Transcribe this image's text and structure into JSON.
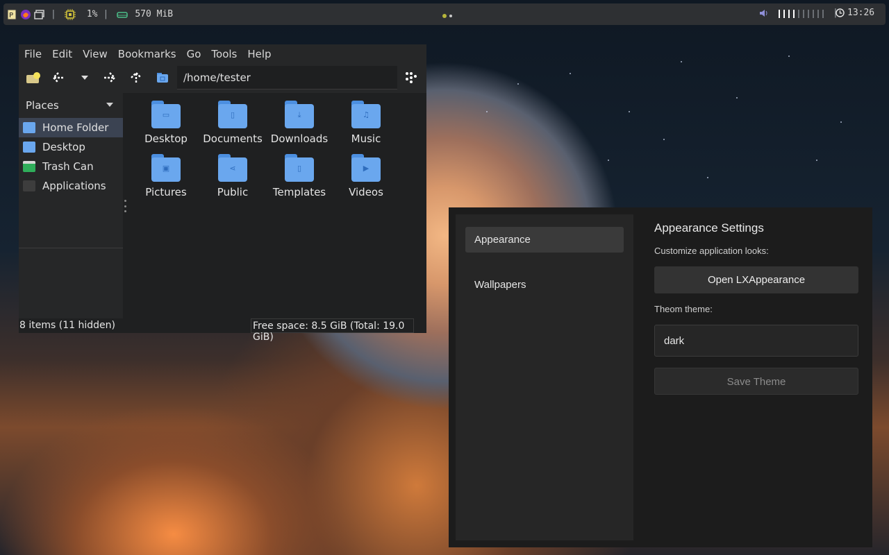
{
  "topbar": {
    "cpu_usage": "1%",
    "memory": "570 MiB",
    "volume_level": 0.4,
    "time": "13:26"
  },
  "file_manager": {
    "menu": [
      "File",
      "Edit",
      "View",
      "Bookmarks",
      "Go",
      "Tools",
      "Help"
    ],
    "path": "/home/tester",
    "places_label": "Places",
    "sidebar_items": [
      {
        "label": "Home Folder",
        "icon": "home-folder-icon",
        "selected": true
      },
      {
        "label": "Desktop",
        "icon": "desktop-folder-icon",
        "selected": false
      },
      {
        "label": "Trash Can",
        "icon": "trash-icon",
        "selected": false
      },
      {
        "label": "Applications",
        "icon": "applications-icon",
        "selected": false
      }
    ],
    "files": [
      {
        "name": "Desktop",
        "icon": "folder-icon"
      },
      {
        "name": "Documents",
        "icon": "documents-folder-icon"
      },
      {
        "name": "Downloads",
        "icon": "downloads-folder-icon"
      },
      {
        "name": "Music",
        "icon": "music-folder-icon"
      },
      {
        "name": "Pictures",
        "icon": "pictures-folder-icon"
      },
      {
        "name": "Public",
        "icon": "public-folder-icon"
      },
      {
        "name": "Templates",
        "icon": "templates-folder-icon"
      },
      {
        "name": "Videos",
        "icon": "videos-folder-icon"
      }
    ],
    "status_left": "8 items (11 hidden)",
    "status_right": "Free space: 8.5 GiB (Total: 19.0 GiB)"
  },
  "settings": {
    "nav": [
      {
        "label": "Appearance",
        "active": true
      },
      {
        "label": "Wallpapers",
        "active": false
      }
    ],
    "title": "Appearance Settings",
    "subtitle": "Customize application looks:",
    "open_button": "Open LXAppearance",
    "theme_label": "Theom theme:",
    "theme_value": "dark",
    "save_button": "Save Theme"
  },
  "colors": {
    "folder_blue": "#6aa7ee",
    "selection": "#3b4352",
    "accent_cpu": "#d4c53a",
    "accent_mem": "#4cc08a"
  }
}
